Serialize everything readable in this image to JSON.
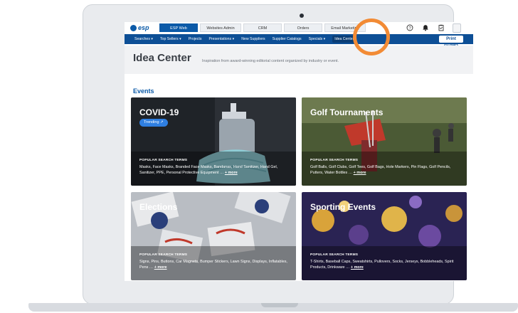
{
  "topbar": {
    "logo_text": "esp",
    "tabs": [
      {
        "label": "ESP Web"
      },
      {
        "label": "Websites Admin"
      },
      {
        "label": "CRM"
      },
      {
        "label": "Orders"
      },
      {
        "label": "Email Marketing"
      }
    ],
    "icons": [
      "help-icon",
      "notification-bell-icon",
      "clipboard-icon",
      "user-avatar-icon"
    ]
  },
  "navbar": {
    "items": [
      {
        "label": "Searches ▾"
      },
      {
        "label": "Top Sellers ▾"
      },
      {
        "label": "Projects"
      },
      {
        "label": "Presentations ▾"
      },
      {
        "label": "New Suppliers"
      },
      {
        "label": "Supplier Catalogs"
      },
      {
        "label": "Specials ▾"
      },
      {
        "label": "Idea Center"
      }
    ],
    "print_badge": "Print GIZMO"
  },
  "page": {
    "title": "Idea Center",
    "description": "Inspiration from award-winning editorial content organized by industry or event."
  },
  "section": {
    "title": "Events"
  },
  "cards": [
    {
      "title": "COVID-19",
      "badge": "Trending ↗",
      "pst_heading": "POPULAR SEARCH TERMS",
      "pst_text": "Masks, Face Masks, Branded Face Masks, Bandanas, Hand Sanitizer, Hand Gel, Sanitizer, PPE, Personal Protective Equipment …",
      "more": "+ more"
    },
    {
      "title": "Golf Tournaments",
      "pst_heading": "POPULAR SEARCH TERMS",
      "pst_text": "Golf Balls, Golf Clubs, Golf Tees, Golf Bags, Hole Markers, Pin Flags, Golf Pencils, Putters, Water Bottles …",
      "more": "+ more"
    },
    {
      "title": "Elections",
      "pst_heading": "POPULAR SEARCH TERMS",
      "pst_text": "Signs, Pins, Buttons, Car Magnets, Bumper Stickers, Lawn Signs, Displays, Inflatables, Pens …",
      "more": "+ more"
    },
    {
      "title": "Sporting Events",
      "pst_heading": "POPULAR SEARCH TERMS",
      "pst_text": "T-Shirts, Baseball Caps, Sweatshirts, Pullovers, Socks, Jerseys, Bobbleheads, Spirit Products, Drinkware …",
      "more": "+ more"
    }
  ],
  "colors": {
    "brand": "#0b5aa8",
    "nav": "#0d4f96",
    "highlight_ring": "#f28b35",
    "badge": "#2f7fe1"
  }
}
